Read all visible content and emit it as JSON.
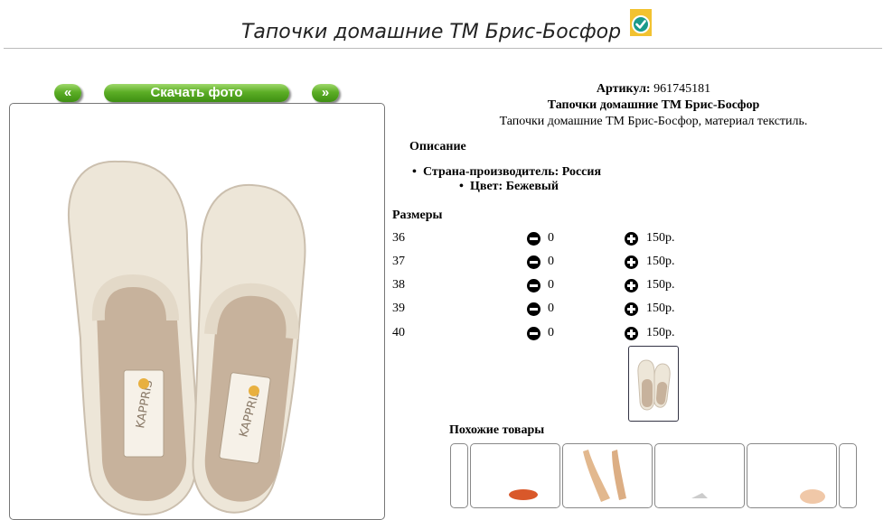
{
  "header": {
    "title": "Тапочки домашние ТМ Брис-Босфор"
  },
  "gallery": {
    "prev_label": "«",
    "download_label": "Скачать фото",
    "next_label": "»"
  },
  "product": {
    "article_label": "Артикул:",
    "article_value": "961745181",
    "name": "Тапочки домашние ТМ Брис-Босфор",
    "short_desc": "Тапочки домашние ТМ Брис-Босфор, материал текстиль.",
    "image_brand_text": "KAPPRIS"
  },
  "description": {
    "title": "Описание",
    "items": [
      "Страна-производитель: Россия",
      "Цвет: Бежевый"
    ]
  },
  "sizes": {
    "title": "Размеры",
    "rows": [
      {
        "size": "36",
        "qty": "0",
        "price": "150р."
      },
      {
        "size": "37",
        "qty": "0",
        "price": "150р."
      },
      {
        "size": "38",
        "qty": "0",
        "price": "150р."
      },
      {
        "size": "39",
        "qty": "0",
        "price": "150р."
      },
      {
        "size": "40",
        "qty": "0",
        "price": "150р."
      }
    ]
  },
  "similar": {
    "title": "Похожие товары"
  },
  "colors": {
    "button_green": "#5cae26",
    "badge_yellow": "#f2c230",
    "badge_teal": "#1a9a8a",
    "slipper_beige": "#ede6d8",
    "insole": "#c7b29c"
  }
}
